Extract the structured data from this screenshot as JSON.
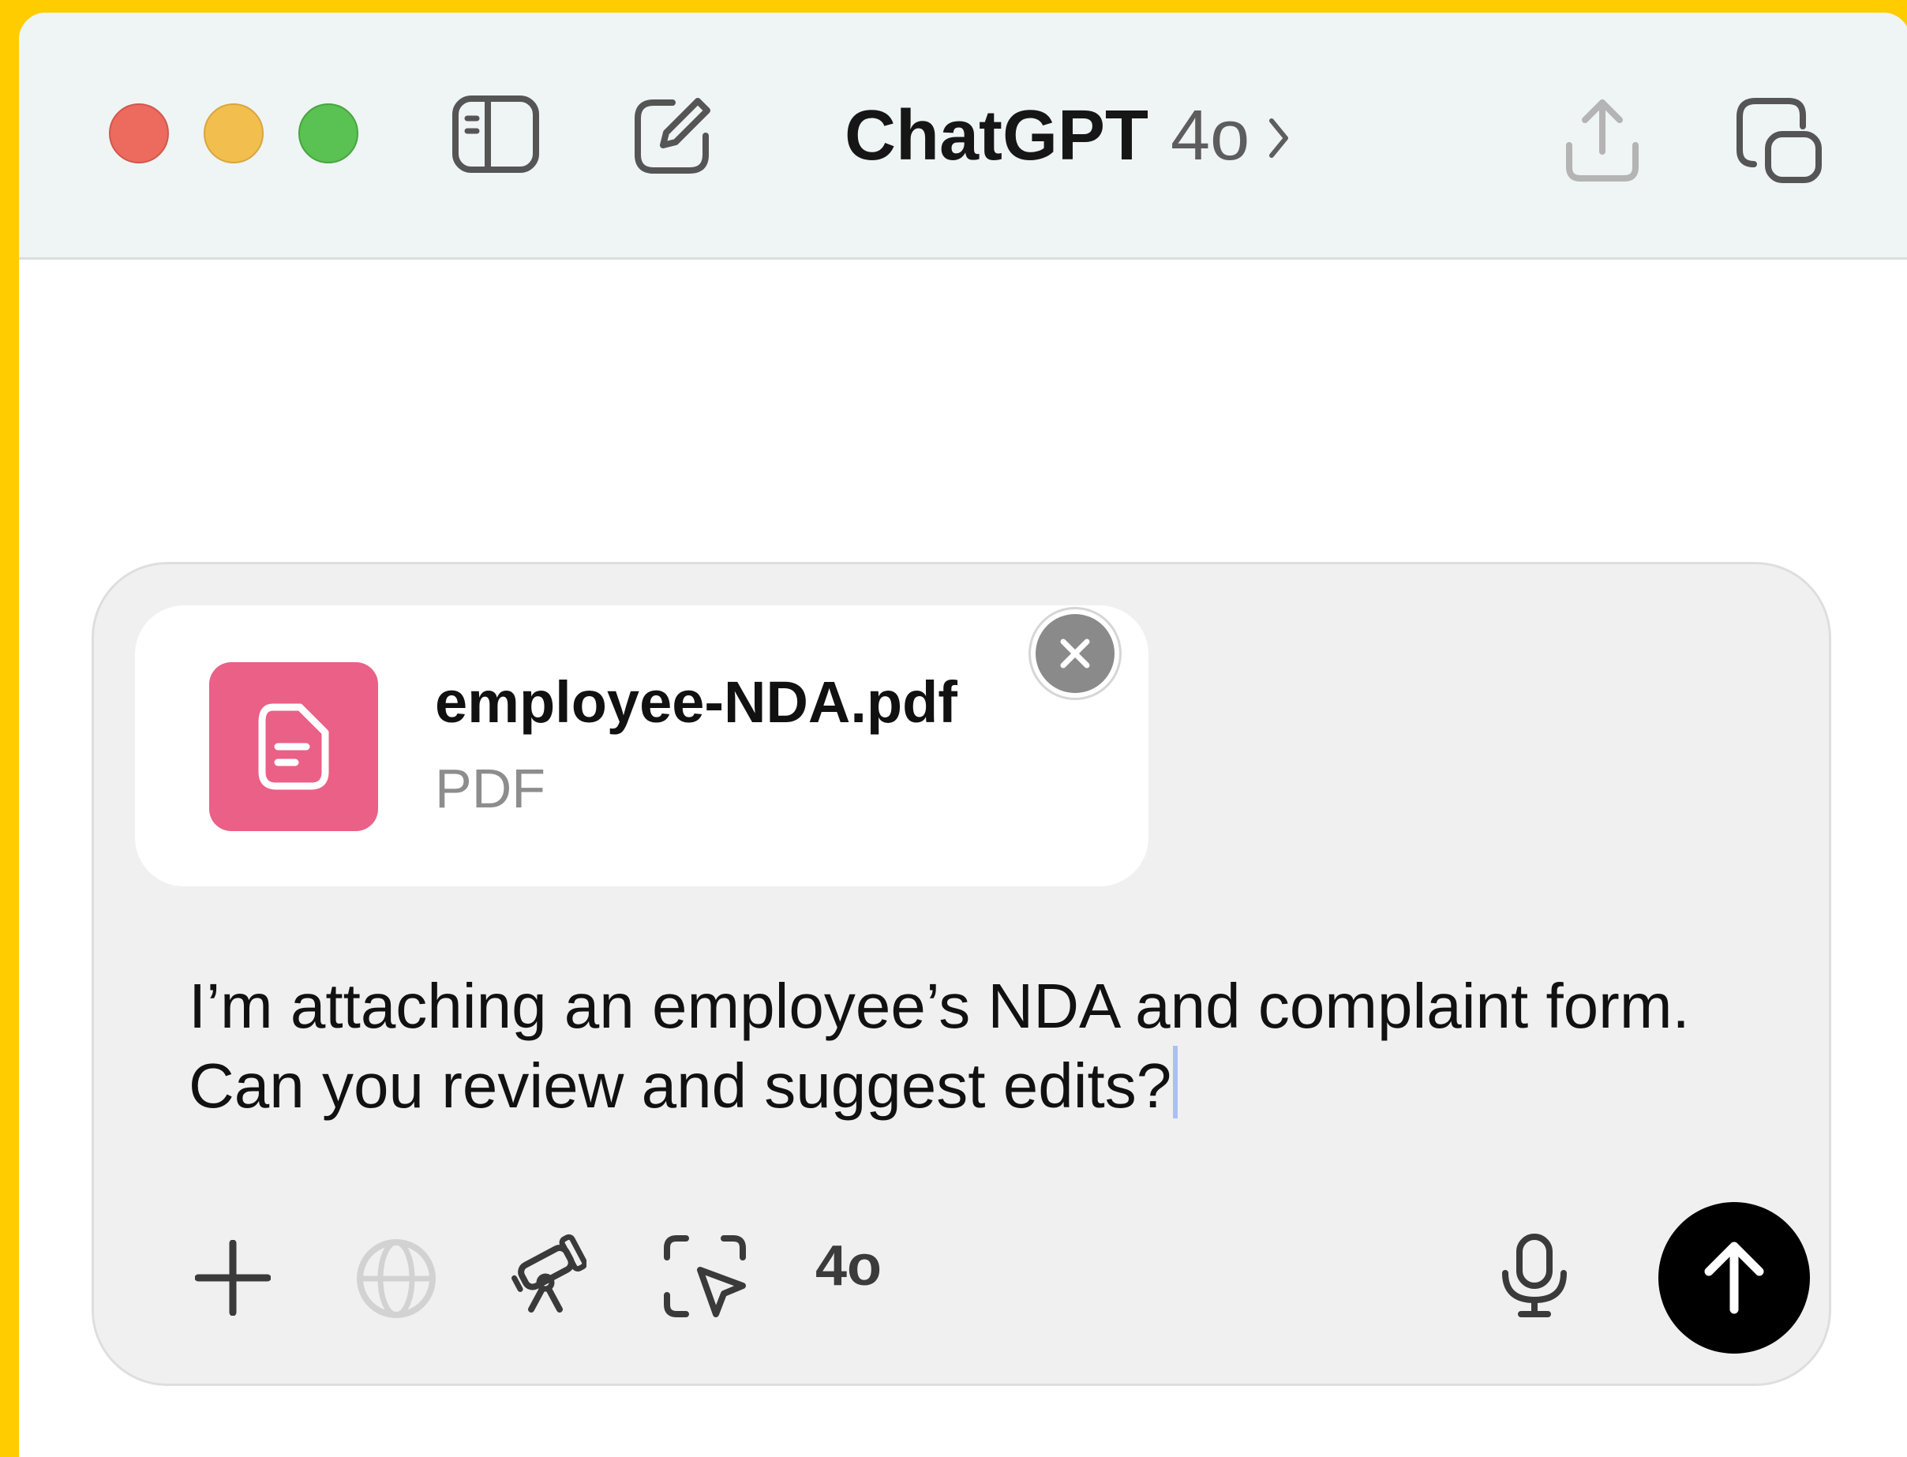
{
  "window": {
    "title": "ChatGPT",
    "model": "4o"
  },
  "titlebar": {
    "icons": [
      "sidebar-toggle-icon",
      "new-chat-icon",
      "chevron-right-icon",
      "share-icon",
      "pop-out-window-icon"
    ]
  },
  "composer": {
    "attachment": {
      "file_name": "employee-NDA.pdf",
      "file_type": "PDF",
      "icon": "document-icon",
      "icon_color": "#ea6087"
    },
    "message": "I’m attaching an employee’s NDA and complaint form. Can you review and suggest edits?",
    "toolbar": {
      "model_label": "4o",
      "icons": [
        "plus-icon",
        "globe-icon",
        "telescope-icon",
        "screen-select-icon",
        "microphone-icon",
        "arrow-up-icon"
      ]
    }
  },
  "colors": {
    "frame": "#FFCC00",
    "titlebar_bg": "#eff4f4",
    "composer_bg": "#f0f0f0",
    "send_button": "#000000"
  }
}
